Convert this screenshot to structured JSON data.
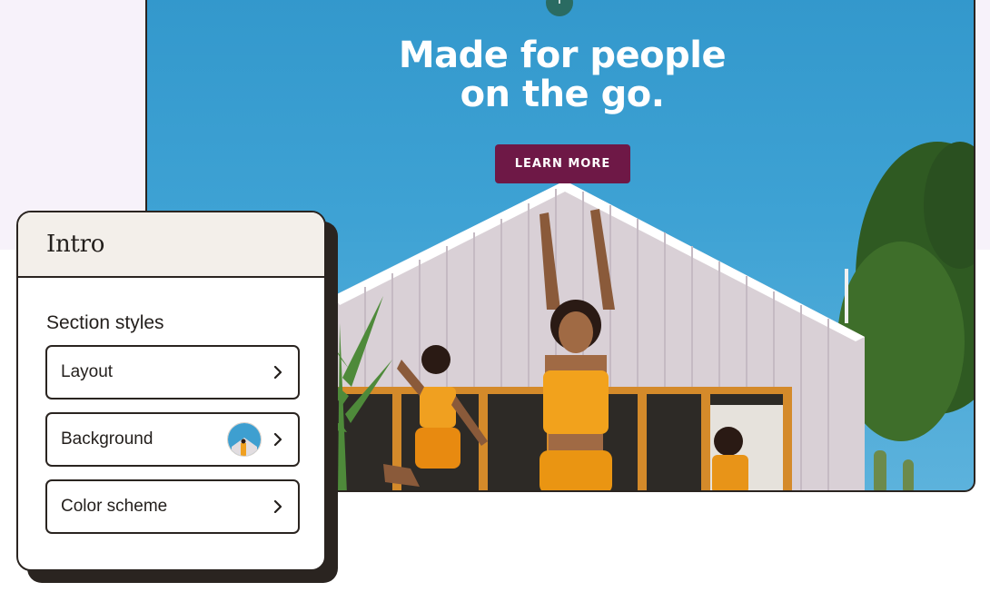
{
  "hero": {
    "title_line1": "Made for people",
    "title_line2": "on the go.",
    "cta_label": "LEARN MORE",
    "add_icon": "+",
    "colors": {
      "sky": "#3ea2d4",
      "cta": "#6e1846",
      "add_button": "#2a6b62"
    }
  },
  "panel": {
    "title": "Intro",
    "section_label": "Section styles",
    "options": [
      {
        "label": "Layout",
        "icon": "chevron-right-icon"
      },
      {
        "label": "Background",
        "icon": "chevron-right-icon",
        "thumbnail": "background-thumbnail"
      },
      {
        "label": "Color scheme",
        "icon": "chevron-right-icon"
      }
    ]
  }
}
